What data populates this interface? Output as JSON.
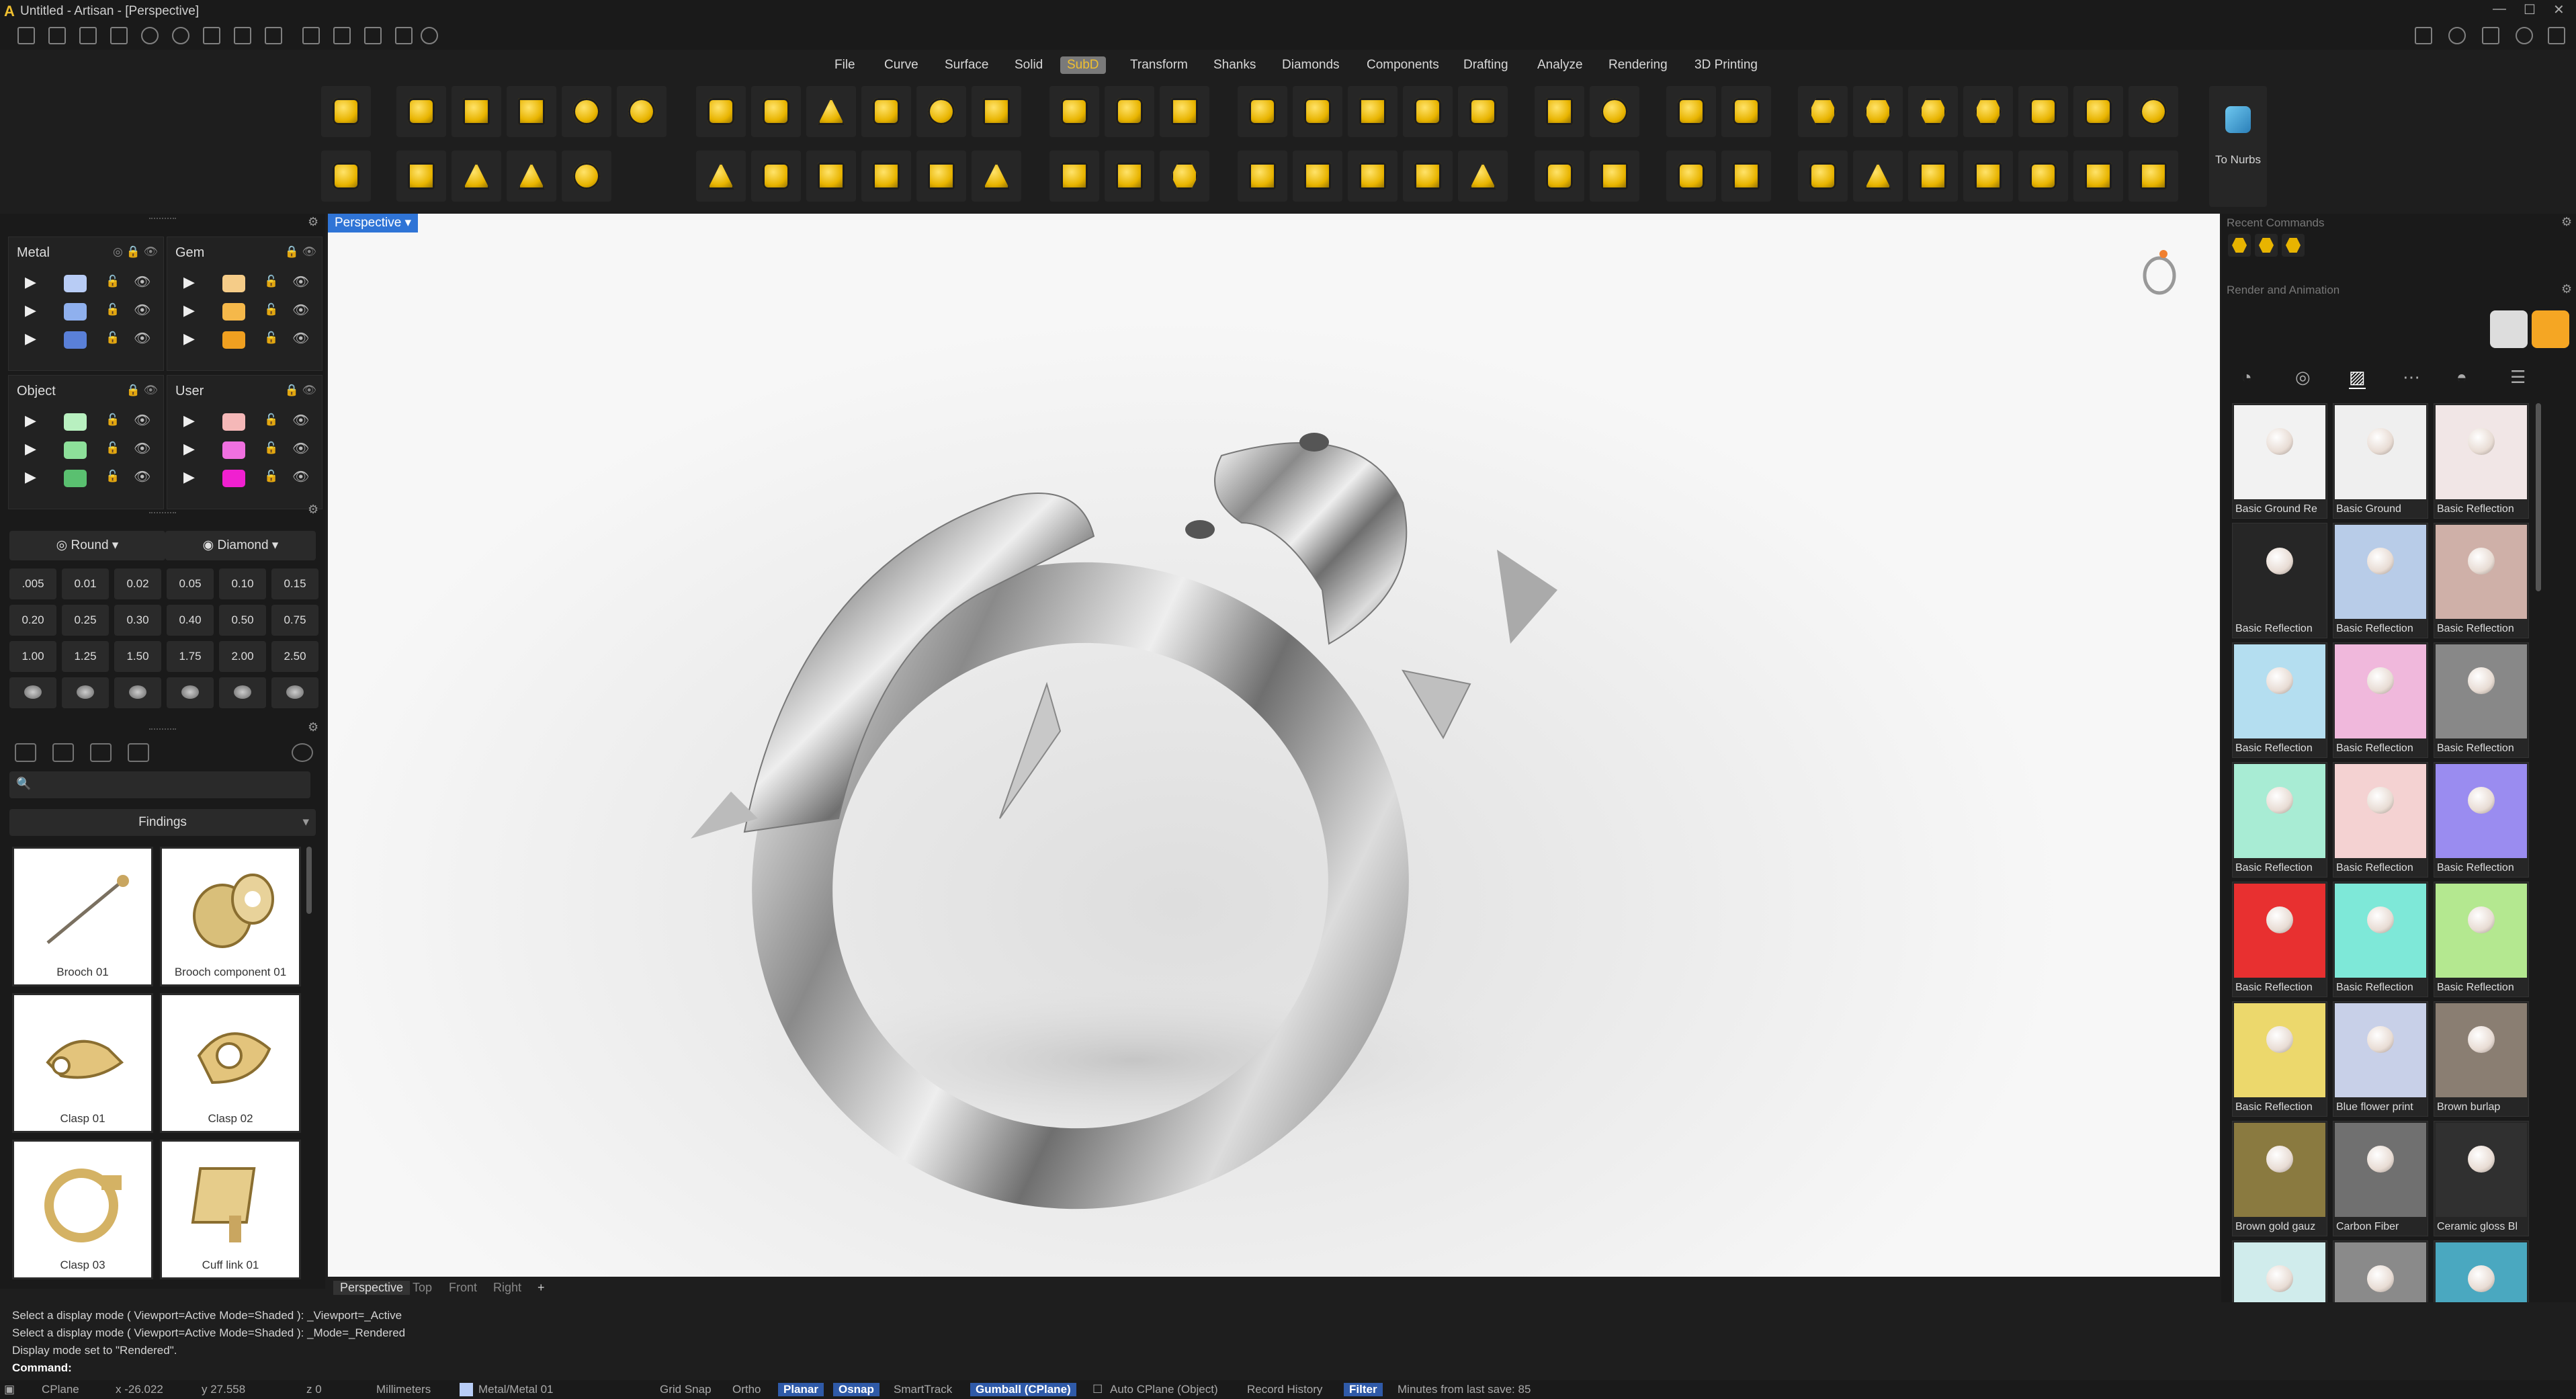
{
  "window": {
    "title": "Untitled - Artisan - [Perspective]"
  },
  "menu": {
    "items": [
      "File",
      "Curve",
      "Surface",
      "Solid",
      "SubD",
      "Transform",
      "Shanks",
      "Diamonds",
      "Components",
      "Drafting",
      "Analyze",
      "Rendering",
      "3D Printing"
    ],
    "active": "SubD"
  },
  "toolbar": {
    "to_nurbs_label": "To Nurbs"
  },
  "layers": {
    "metal": {
      "label": "Metal",
      "colors": [
        "#b8ccf5",
        "#8fb0ee",
        "#5a80d8"
      ]
    },
    "gem": {
      "label": "Gem",
      "colors": [
        "#f5cc88",
        "#f5b84a",
        "#f0a020"
      ]
    },
    "object": {
      "label": "Object",
      "colors": [
        "#b8f0c0",
        "#8de09a",
        "#5ac070"
      ]
    },
    "user": {
      "label": "User",
      "colors": [
        "#f5b8b8",
        "#f070e0",
        "#f020d0"
      ]
    }
  },
  "gem_tools": {
    "round_label": "Round",
    "diamond_label": "Diamond",
    "sizes": [
      ".005",
      "0.01",
      "0.02",
      "0.05",
      "0.10",
      "0.15",
      "0.20",
      "0.25",
      "0.30",
      "0.40",
      "0.50",
      "0.75",
      "1.00",
      "1.25",
      "1.50",
      "1.75",
      "2.00",
      "2.50"
    ]
  },
  "library": {
    "category": "Findings",
    "search_placeholder": "",
    "items": [
      "Brooch 01",
      "Brooch component 01",
      "Clasp 01",
      "Clasp 02",
      "Clasp 03",
      "Cuff link 01"
    ]
  },
  "viewport": {
    "active_label": "Perspective",
    "tabs": [
      "Perspective",
      "Top",
      "Front",
      "Right"
    ],
    "add_tab": "+"
  },
  "right_panel": {
    "recent_title": "Recent Commands",
    "render_title": "Render and Animation",
    "materials": [
      {
        "label": "Basic Ground Re",
        "color": "#f2f2f2"
      },
      {
        "label": "Basic Ground",
        "color": "#efefef"
      },
      {
        "label": "Basic Reflection",
        "color": "#f1e6e6"
      },
      {
        "label": "Basic Reflection",
        "color": "#262626"
      },
      {
        "label": "Basic Reflection",
        "color": "#b8cce8"
      },
      {
        "label": "Basic Reflection",
        "color": "#cfb0a8"
      },
      {
        "label": "Basic Reflection",
        "color": "#b4def0"
      },
      {
        "label": "Basic Reflection",
        "color": "#f0b8dc"
      },
      {
        "label": "Basic Reflection",
        "color": "#888888"
      },
      {
        "label": "Basic Reflection",
        "color": "#a8ecd4"
      },
      {
        "label": "Basic Reflection",
        "color": "#f4d2d2"
      },
      {
        "label": "Basic Reflection",
        "color": "#9a8cf0"
      },
      {
        "label": "Basic Reflection",
        "color": "#e83030"
      },
      {
        "label": "Basic Reflection",
        "color": "#7ee8d8"
      },
      {
        "label": "Basic Reflection",
        "color": "#b4e890"
      },
      {
        "label": "Basic Reflection",
        "color": "#ecd86c"
      },
      {
        "label": "Blue flower print",
        "color": "#c8d0e8"
      },
      {
        "label": "Brown burlap",
        "color": "#8a7e72"
      },
      {
        "label": "Brown gold gauz",
        "color": "#8a7a40"
      },
      {
        "label": "Carbon Fiber",
        "color": "#707070"
      },
      {
        "label": "Ceramic gloss Bl",
        "color": "#303030"
      },
      {
        "label": "",
        "color": "#d0ecec"
      },
      {
        "label": "",
        "color": "#8a8a8a"
      },
      {
        "label": "",
        "color": "#4aa8c0"
      }
    ]
  },
  "command": {
    "history": [
      "Select a display mode ( Viewport=Active  Mode=Shaded ): _Viewport=_Active",
      "Select a display mode ( Viewport=Active  Mode=Shaded ): _Mode=_Rendered",
      "Display mode set to \"Rendered\"."
    ],
    "prompt": "Command:"
  },
  "status": {
    "cplane": "CPlane",
    "x": "x -26.022",
    "y": "y 27.558",
    "z": "z 0",
    "units": "Millimeters",
    "layer": "Metal/Metal 01",
    "grid_snap": "Grid Snap",
    "ortho": "Ortho",
    "planar": "Planar",
    "osnap": "Osnap",
    "smarttrack": "SmartTrack",
    "gumball": "Gumball (CPlane)",
    "auto_cplane": "Auto CPlane (Object)",
    "record_history": "Record History",
    "filter": "Filter",
    "last_save": "Minutes from last save: 85"
  }
}
